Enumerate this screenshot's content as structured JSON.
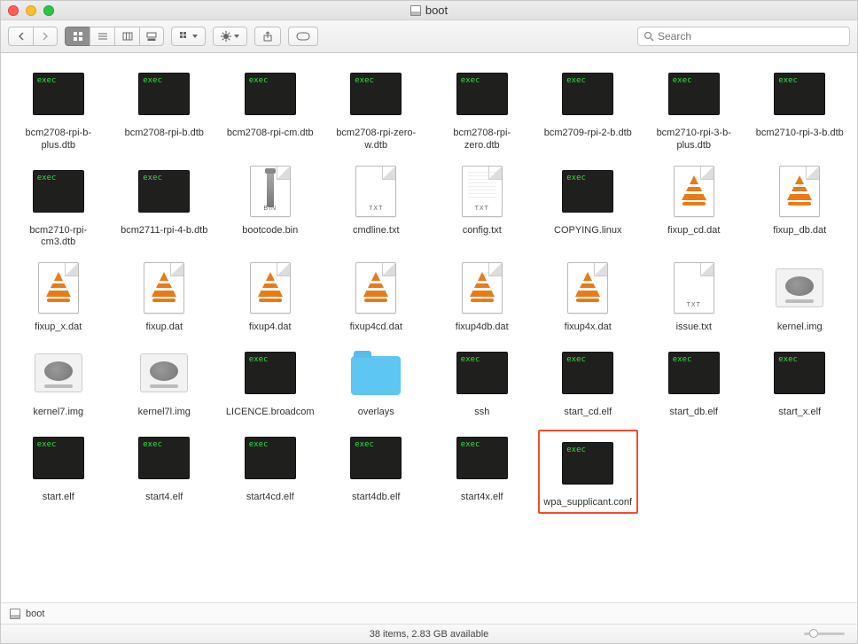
{
  "window": {
    "title": "boot"
  },
  "search": {
    "placeholder": "Search"
  },
  "pathbar": {
    "location": "boot"
  },
  "status": {
    "text": "38 items, 2.83 GB available"
  },
  "files": [
    {
      "name": "bcm2708-rpi-b-plus.dtb",
      "type": "exec"
    },
    {
      "name": "bcm2708-rpi-b.dtb",
      "type": "exec"
    },
    {
      "name": "bcm2708-rpi-cm.dtb",
      "type": "exec"
    },
    {
      "name": "bcm2708-rpi-zero-w.dtb",
      "type": "exec"
    },
    {
      "name": "bcm2708-rpi-zero.dtb",
      "type": "exec"
    },
    {
      "name": "bcm2709-rpi-2-b.dtb",
      "type": "exec"
    },
    {
      "name": "bcm2710-rpi-3-b-plus.dtb",
      "type": "exec"
    },
    {
      "name": "bcm2710-rpi-3-b.dtb",
      "type": "exec"
    },
    {
      "name": "bcm2710-rpi-cm3.dtb",
      "type": "exec"
    },
    {
      "name": "bcm2711-rpi-4-b.dtb",
      "type": "exec"
    },
    {
      "name": "bootcode.bin",
      "type": "bin",
      "badge": "BIN"
    },
    {
      "name": "cmdline.txt",
      "type": "txt",
      "badge": "TXT"
    },
    {
      "name": "config.txt",
      "type": "txtlines",
      "badge": "TXT"
    },
    {
      "name": "COPYING.linux",
      "type": "exec"
    },
    {
      "name": "fixup_cd.dat",
      "type": "vlc"
    },
    {
      "name": "fixup_db.dat",
      "type": "vlc"
    },
    {
      "name": "fixup_x.dat",
      "type": "vlc"
    },
    {
      "name": "fixup.dat",
      "type": "vlc"
    },
    {
      "name": "fixup4.dat",
      "type": "vlc"
    },
    {
      "name": "fixup4cd.dat",
      "type": "vlc"
    },
    {
      "name": "fixup4db.dat",
      "type": "vlc"
    },
    {
      "name": "fixup4x.dat",
      "type": "vlc"
    },
    {
      "name": "issue.txt",
      "type": "txt",
      "badge": "TXT"
    },
    {
      "name": "kernel.img",
      "type": "img"
    },
    {
      "name": "kernel7.img",
      "type": "img"
    },
    {
      "name": "kernel7l.img",
      "type": "img"
    },
    {
      "name": "LICENCE.broadcom",
      "type": "exec"
    },
    {
      "name": "overlays",
      "type": "folder"
    },
    {
      "name": "ssh",
      "type": "exec"
    },
    {
      "name": "start_cd.elf",
      "type": "exec"
    },
    {
      "name": "start_db.elf",
      "type": "exec"
    },
    {
      "name": "start_x.elf",
      "type": "exec"
    },
    {
      "name": "start.elf",
      "type": "exec"
    },
    {
      "name": "start4.elf",
      "type": "exec"
    },
    {
      "name": "start4cd.elf",
      "type": "exec"
    },
    {
      "name": "start4db.elf",
      "type": "exec"
    },
    {
      "name": "start4x.elf",
      "type": "exec"
    },
    {
      "name": "wpa_supplicant.conf",
      "type": "exec",
      "highlighted": true
    }
  ]
}
